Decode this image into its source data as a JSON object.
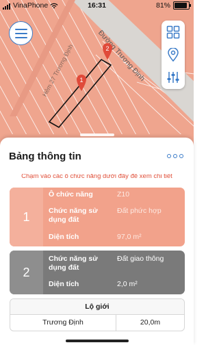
{
  "status_bar": {
    "carrier": "VinaPhone",
    "time": "16:31",
    "battery": "81%"
  },
  "map": {
    "street_main": "Đường Trương Định",
    "street_alley": "Hẻm 27 Trương Định",
    "marker_1": "1",
    "marker_2": "2",
    "colors": {
      "land": "#efa58e",
      "road": "#d9d6d2",
      "accent": "#3a7bc8",
      "marker": "#e04a3a"
    }
  },
  "toolbar": {
    "menu_icon": "hamburger-menu-icon",
    "grid_icon": "grid-icon",
    "location_icon": "location-pin-icon",
    "filter_icon": "sliders-icon"
  },
  "panel": {
    "title": "Bảng thông tin",
    "more_icon": "more-icon",
    "hint": "Chạm vào các ô chức năng dưới đây để xem chi tiết",
    "cards": [
      {
        "number": "1",
        "o_label": "Ô chức năng",
        "o_value": "Z10",
        "function_label": "Chức năng sử dụng đất",
        "function_value": "Đất phức hợp",
        "area_label": "Diện tích",
        "area_value": "97,0 m²"
      },
      {
        "number": "2",
        "function_label": "Chức năng sử dụng đất",
        "function_value": "Đất giao thông",
        "area_label": "Diện tích",
        "area_value": "2,0 m²"
      }
    ],
    "table": {
      "header": "Lộ giới",
      "rows": [
        {
          "street": "Trương Định",
          "width": "20,0m"
        }
      ]
    }
  }
}
